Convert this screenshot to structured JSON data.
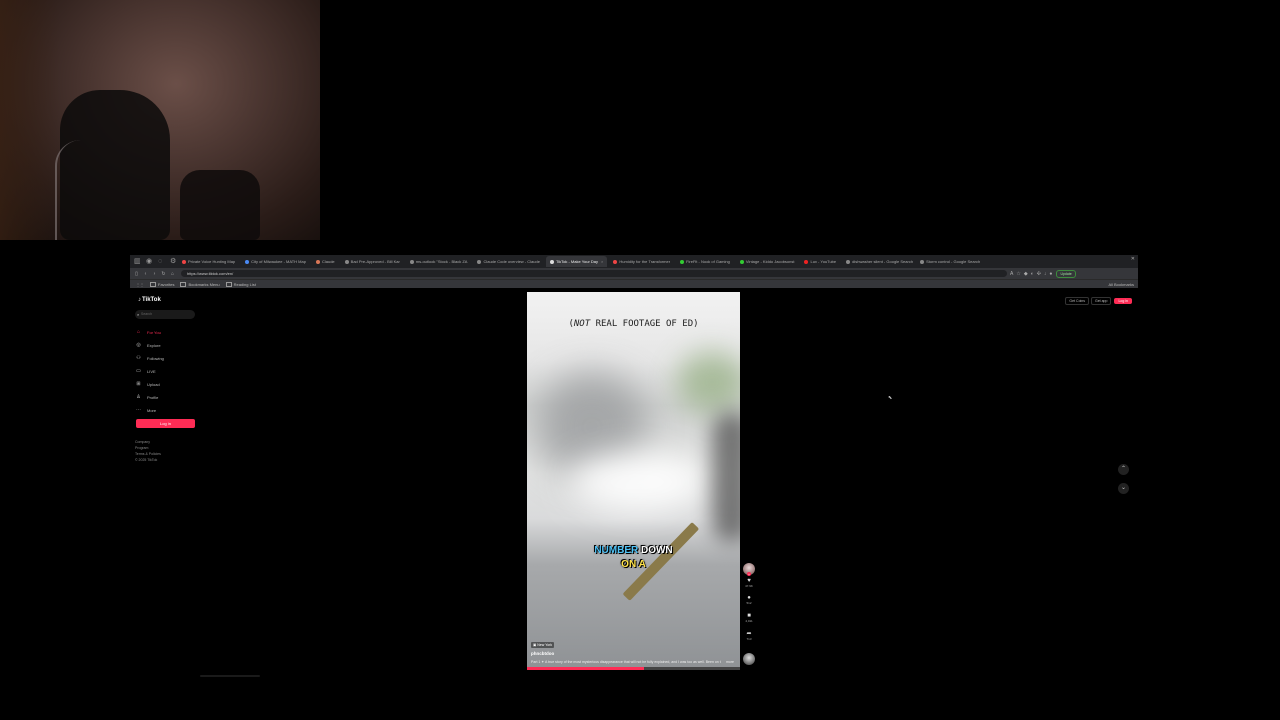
{
  "browser": {
    "tabs": [
      {
        "label": "Private Voice Hunting Map",
        "color": "#e44"
      },
      {
        "label": "City of Milwaukee - MATH Map",
        "color": "#4a8af4"
      },
      {
        "label": "Claude",
        "color": "#d97757"
      },
      {
        "label": "Bad Pre-Approved - Bill Kar",
        "color": "#888"
      },
      {
        "label": "ms-outlook \"Stock - Black ZA",
        "color": "#888"
      },
      {
        "label": "Claude Code overview - Claude",
        "color": "#888"
      },
      {
        "label": "TikTok - Make Your Day",
        "color": "#ddd",
        "active": true
      },
      {
        "label": "Humidity for the Transformer",
        "color": "#e44"
      },
      {
        "label": "FireFit - Nook of Gaming",
        "color": "#3c3"
      },
      {
        "label": "Vintage - Kiddo Jacobsonst",
        "color": "#3c3"
      },
      {
        "label": "Lux - YouTube",
        "color": "#e22"
      },
      {
        "label": "dishwasher silent - Google Search",
        "color": "#888"
      },
      {
        "label": "Storm control - Google Search",
        "color": "#888"
      }
    ],
    "url": "https://www.tiktok.com/en/",
    "update_label": "Update",
    "bookmarks": [
      "Favorites",
      "Bookmarks Menu",
      "Reading List"
    ],
    "all_bookmarks": "All Bookmarks"
  },
  "tiktok": {
    "logo": "TikTok",
    "search_placeholder": "Search",
    "nav": [
      {
        "label": "For You",
        "icon": "⌂",
        "active": true
      },
      {
        "label": "Explore",
        "icon": "◎"
      },
      {
        "label": "Following",
        "icon": "⚇"
      },
      {
        "label": "LIVE",
        "icon": "▭"
      },
      {
        "label": "Upload",
        "icon": "⊞"
      },
      {
        "label": "Profile",
        "icon": "♙"
      },
      {
        "label": "More",
        "icon": "⋯"
      }
    ],
    "side_login": "Log in",
    "footer": [
      "Company",
      "Program",
      "Terms & Policies",
      "© 2025 TikTok"
    ],
    "top_right": {
      "get_coins": "Get Coins",
      "get_app": "Get app",
      "login": "Log in"
    }
  },
  "video": {
    "top_caption_prefix": "(",
    "top_caption_em": "NOT",
    "top_caption_rest": " REAL FOOTAGE OF ED)",
    "subtitle_word1": "NUMBER",
    "subtitle_word2": " DOWN",
    "subtitle_line2_word1": "ON",
    "subtitle_line2_word2": " A",
    "location": "New York",
    "author": "phncbtdoo",
    "description": "Part 1 ✦ A true story of the most mysterious disappearance that will not be fully explained, and I was too as well. Been on the",
    "more": "more",
    "progress": 0.55,
    "actions": [
      {
        "name": "like",
        "icon": "♥",
        "count": "47.9K"
      },
      {
        "name": "comment",
        "icon": "●",
        "count": "512"
      },
      {
        "name": "save",
        "icon": "■",
        "count": "4,011"
      },
      {
        "name": "share",
        "icon": "➦",
        "count": "713"
      }
    ]
  },
  "colors": {
    "accent": "#fe2c55",
    "subtitle_highlight_1": "#4fc3f7",
    "subtitle_highlight_2": "#ffe34a"
  }
}
